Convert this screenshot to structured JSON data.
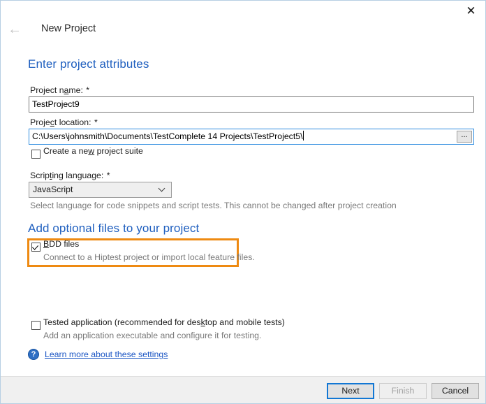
{
  "window": {
    "title": "New Project",
    "close_label": "✕",
    "back_label": "←"
  },
  "headings": {
    "attributes": "Enter project attributes",
    "optional_files": "Add optional files to your project"
  },
  "fields": {
    "project_name": {
      "label_before": "Project n",
      "label_accel": "a",
      "label_after": "me: ",
      "required_mark": "*",
      "value": "TestProject9"
    },
    "project_location": {
      "label_before": "Proje",
      "label_accel": "c",
      "label_after": "t location: ",
      "required_mark": "*",
      "value": "C:\\Users\\johnsmith\\Documents\\TestComplete 14 Projects\\TestProject5\\",
      "browse_label": "..."
    },
    "create_suite": {
      "label_before": "Create a ne",
      "label_accel": "w",
      "label_after": " project suite",
      "checked": false
    },
    "scripting_language": {
      "label_before": "Scrip",
      "label_accel": "t",
      "label_after": "ing language: ",
      "required_mark": "*",
      "value": "JavaScript",
      "hint": "Select language for code snippets and script tests. This cannot be changed after project creation"
    }
  },
  "optional_files": {
    "bdd": {
      "label_accel": "B",
      "label_after": "DD files",
      "sublabel": "Connect to a Hiptest project or import local feature files.",
      "checked": true,
      "highlight_color": "#ee8a12"
    },
    "tested_application": {
      "label_before": "Tested application (recommended for des",
      "label_accel": "k",
      "label_after": "top and mobile tests)",
      "sublabel": "Add an application executable and configure it for testing.",
      "checked": false
    }
  },
  "help": {
    "icon_glyph": "?",
    "link_text": "Learn more about these settings"
  },
  "footer": {
    "next_label": "Next",
    "finish_label": "Finish",
    "cancel_label": "Cancel"
  }
}
